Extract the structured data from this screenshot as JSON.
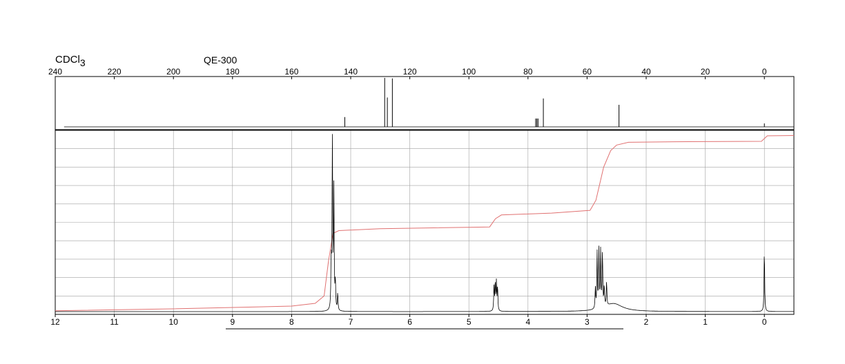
{
  "header": {
    "solvent_base": "CDCl",
    "solvent_sub": "3",
    "instrument": "QE-300"
  },
  "chart_data": [
    {
      "id": "c13",
      "type": "line",
      "x_axis": {
        "range": [
          240,
          -10
        ],
        "ticks": [
          240,
          220,
          200,
          180,
          160,
          140,
          120,
          100,
          80,
          60,
          40,
          20,
          0
        ],
        "reversed": true
      },
      "peaks": [
        {
          "x": 142.0,
          "height": 0.2
        },
        {
          "x": 128.5,
          "height": 1.0
        },
        {
          "x": 127.6,
          "height": 0.6
        },
        {
          "x": 125.9,
          "height": 0.99
        },
        {
          "x": 77.4,
          "height": 0.17
        },
        {
          "x": 77.0,
          "height": 0.17
        },
        {
          "x": 76.6,
          "height": 0.17
        },
        {
          "x": 74.8,
          "height": 0.58
        },
        {
          "x": 49.2,
          "height": 0.45
        },
        {
          "x": 0.0,
          "height": 0.07
        }
      ]
    },
    {
      "id": "h1",
      "type": "line",
      "x_axis": {
        "range": [
          12,
          -0.5
        ],
        "ticks": [
          12,
          11,
          10,
          9,
          8,
          7,
          6,
          5,
          4,
          3,
          2,
          1,
          0
        ],
        "reversed": true
      },
      "grid": true,
      "peaks": [
        {
          "x": 7.31,
          "height": 1.0
        },
        {
          "x": 7.285,
          "height": 0.7
        },
        {
          "x": 7.33,
          "height": 0.28
        },
        {
          "x": 7.26,
          "height": 0.16
        },
        {
          "x": 7.22,
          "height": 0.1
        },
        {
          "x": 4.575,
          "height": 0.14
        },
        {
          "x": 4.555,
          "height": 0.16
        },
        {
          "x": 4.535,
          "height": 0.16
        },
        {
          "x": 4.515,
          "height": 0.14
        },
        {
          "x": 2.86,
          "height": 0.12
        },
        {
          "x": 2.83,
          "height": 0.32
        },
        {
          "x": 2.8,
          "height": 0.33
        },
        {
          "x": 2.77,
          "height": 0.33
        },
        {
          "x": 2.74,
          "height": 0.32
        },
        {
          "x": 2.71,
          "height": 0.12
        },
        {
          "x": 2.67,
          "height": 0.14
        },
        {
          "x": 0.0,
          "height": 0.36
        }
      ],
      "broad_peaks": [
        {
          "x": 2.55,
          "height": 0.045,
          "width": 0.18
        }
      ],
      "integral_curve": {
        "points": [
          [
            12.0,
            0.02
          ],
          [
            10.0,
            0.03
          ],
          [
            8.0,
            0.045
          ],
          [
            7.6,
            0.06
          ],
          [
            7.45,
            0.1
          ],
          [
            7.38,
            0.28
          ],
          [
            7.3,
            0.44
          ],
          [
            7.2,
            0.455
          ],
          [
            6.5,
            0.465
          ],
          [
            4.65,
            0.475
          ],
          [
            4.55,
            0.52
          ],
          [
            4.45,
            0.54
          ],
          [
            3.6,
            0.55
          ],
          [
            2.95,
            0.565
          ],
          [
            2.85,
            0.62
          ],
          [
            2.72,
            0.8
          ],
          [
            2.6,
            0.89
          ],
          [
            2.5,
            0.92
          ],
          [
            2.3,
            0.935
          ],
          [
            1.5,
            0.938
          ],
          [
            0.05,
            0.94
          ],
          [
            -0.05,
            0.97
          ],
          [
            -0.5,
            0.972
          ]
        ]
      }
    }
  ]
}
